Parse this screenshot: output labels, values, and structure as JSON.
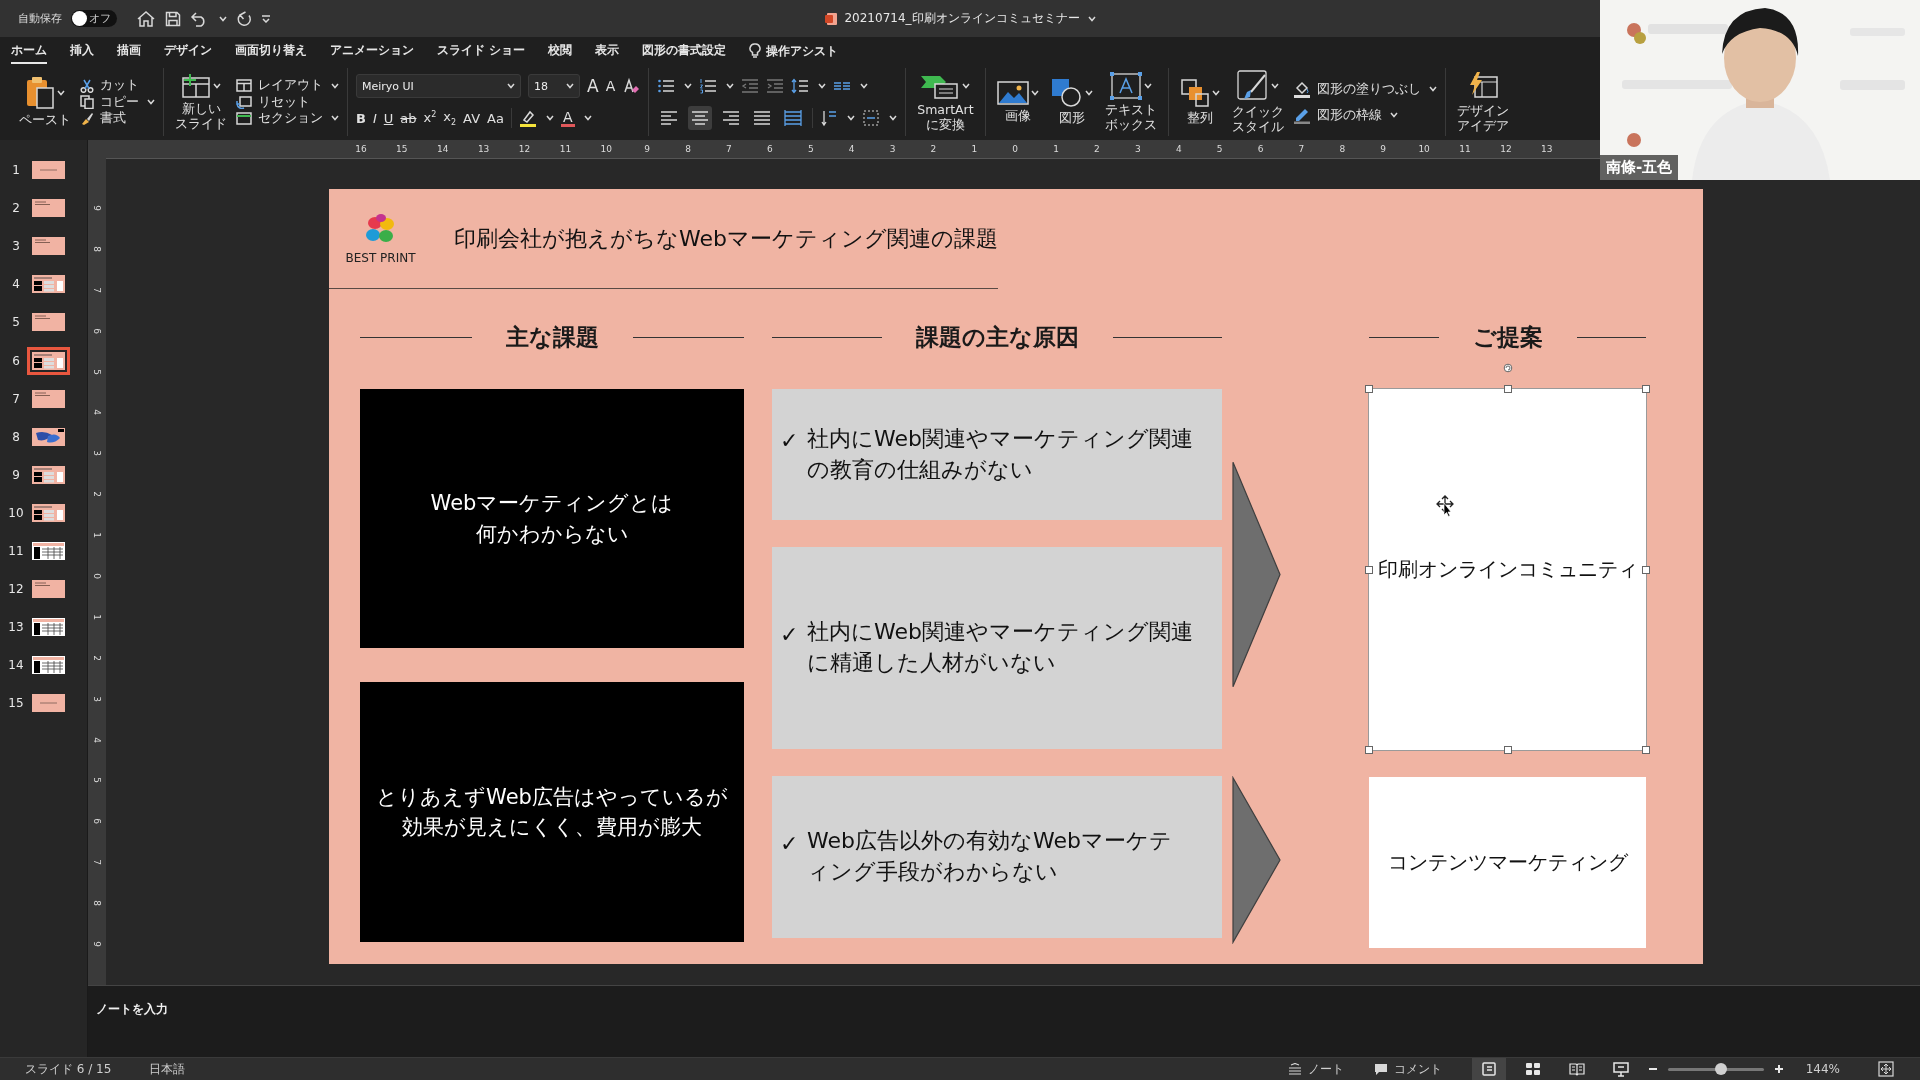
{
  "title_bar": {
    "autosave_label": "自動保存",
    "autosave_toggle": {
      "label": "オフ",
      "on": false
    },
    "document_title": "20210714_印刷オンラインコミュセミナー"
  },
  "ribbon_tabs": [
    {
      "label": "ホーム",
      "selected": true
    },
    {
      "label": "挿入",
      "selected": false
    },
    {
      "label": "描画",
      "selected": false
    },
    {
      "label": "デザイン",
      "selected": false
    },
    {
      "label": "画面切り替え",
      "selected": false
    },
    {
      "label": "アニメーション",
      "selected": false
    },
    {
      "label": "スライド ショー",
      "selected": false
    },
    {
      "label": "校閲",
      "selected": false
    },
    {
      "label": "表示",
      "selected": false
    },
    {
      "label": "図形の書式設定",
      "selected": false
    }
  ],
  "tell_me": {
    "label": "操作アシスト"
  },
  "ribbon": {
    "clipboard": {
      "paste": "ペースト",
      "cut": "カット",
      "copy": "コピー",
      "format_painter": "書式"
    },
    "slides": {
      "new_slide": [
        "新しい",
        "スライド"
      ],
      "layout": "レイアウト",
      "reset": "リセット",
      "section": "セクション"
    },
    "font": {
      "font_name": "Meiryo UI",
      "font_size": "18",
      "grow": "A",
      "shrink": "A",
      "styles": [
        "B",
        "I",
        "U",
        "ab",
        "x$^{2}$",
        "x$_{2}$",
        "AV",
        "Aa"
      ],
      "font_color": "A"
    },
    "paragraph": {
      "alignment": [
        {
          "selected": false
        },
        {
          "selected": true
        },
        {
          "selected": false
        },
        {
          "selected": false
        },
        {
          "selected": false
        }
      ]
    },
    "drawing": {
      "smartart": [
        "SmartArt",
        "に変換"
      ],
      "picture": "画像",
      "shapes": "図形",
      "text_box": [
        "テキスト",
        "ボックス"
      ],
      "arrange": "整列",
      "quick_styles": [
        "クイック",
        "スタイル"
      ],
      "shape_fill": "図形の塗りつぶし",
      "shape_outline": "図形の枠線",
      "design_ideas": [
        "デザイン",
        "アイデア"
      ]
    }
  },
  "ruler": {
    "horizontal": [
      "16",
      "15",
      "14",
      "13",
      "12",
      "11",
      "10",
      "9",
      "8",
      "7",
      "6",
      "5",
      "4",
      "3",
      "2",
      "1",
      "0",
      "1",
      "2",
      "3",
      "4",
      "5",
      "6",
      "7",
      "8",
      "9",
      "10",
      "11",
      "12",
      "13"
    ],
    "vertical": [
      "9",
      "8",
      "7",
      "6",
      "5",
      "4",
      "3",
      "2",
      "1",
      "0",
      "1",
      "2",
      "3",
      "4",
      "5",
      "6",
      "7",
      "8",
      "9"
    ]
  },
  "thumbnails": [
    {
      "number": "1",
      "selected": false,
      "kind": "title"
    },
    {
      "number": "2",
      "selected": false,
      "kind": "text"
    },
    {
      "number": "3",
      "selected": false,
      "kind": "text"
    },
    {
      "number": "4",
      "selected": false,
      "kind": "layout"
    },
    {
      "number": "5",
      "selected": false,
      "kind": "text"
    },
    {
      "number": "6",
      "selected": true,
      "kind": "layout"
    },
    {
      "number": "7",
      "selected": false,
      "kind": "text"
    },
    {
      "number": "8",
      "selected": false,
      "kind": "graphic"
    },
    {
      "number": "9",
      "selected": false,
      "kind": "layout"
    },
    {
      "number": "10",
      "selected": false,
      "kind": "layout"
    },
    {
      "number": "11",
      "selected": false,
      "kind": "table"
    },
    {
      "number": "12",
      "selected": false,
      "kind": "text"
    },
    {
      "number": "13",
      "selected": false,
      "kind": "table"
    },
    {
      "number": "14",
      "selected": false,
      "kind": "table"
    },
    {
      "number": "15",
      "selected": false,
      "kind": "title"
    }
  ],
  "slide": {
    "logo_text": "BEST PRINT",
    "title": "印刷会社が抱えがちなWebマーケティング関連の課題",
    "headings": [
      "主な課題",
      "課題の主な原因",
      "ご提案"
    ],
    "issues": [
      "Webマーケティングとは何かわからない",
      "とりあえずWeb広告はやっているが効果が見えにくく、費用が膨大"
    ],
    "causes": [
      {
        "bullet": "✓",
        "text": "社内にWeb関連やマーケティング関連の教育の仕組みがない"
      },
      {
        "bullet": "✓",
        "text": "社内にWeb関連やマーケティング関連に精通した人材がいない"
      },
      {
        "bullet": "✓",
        "text": "Web広告以外の有効なWebマーケティング手段がわからない"
      }
    ],
    "proposals": [
      {
        "text": "印刷オンラインコミュニティ",
        "selected": true
      },
      {
        "text": "コンテンツマーケティング",
        "selected": false
      }
    ]
  },
  "notes": {
    "placeholder": "ノートを入力"
  },
  "status_bar": {
    "slide_counter": "スライド 6 / 15",
    "language": "日本語",
    "notes_button": "ノート",
    "comments_button": "コメント",
    "views": [
      {
        "kind": "normal",
        "selected": true
      },
      {
        "kind": "sorter",
        "selected": false
      },
      {
        "kind": "reading",
        "selected": false
      },
      {
        "kind": "slideshow",
        "selected": false
      }
    ],
    "zoom": {
      "level": 0.56
    },
    "zoom_percent": "144%"
  },
  "webcam": {
    "kind": "picture",
    "name_label": "南條-五色"
  }
}
